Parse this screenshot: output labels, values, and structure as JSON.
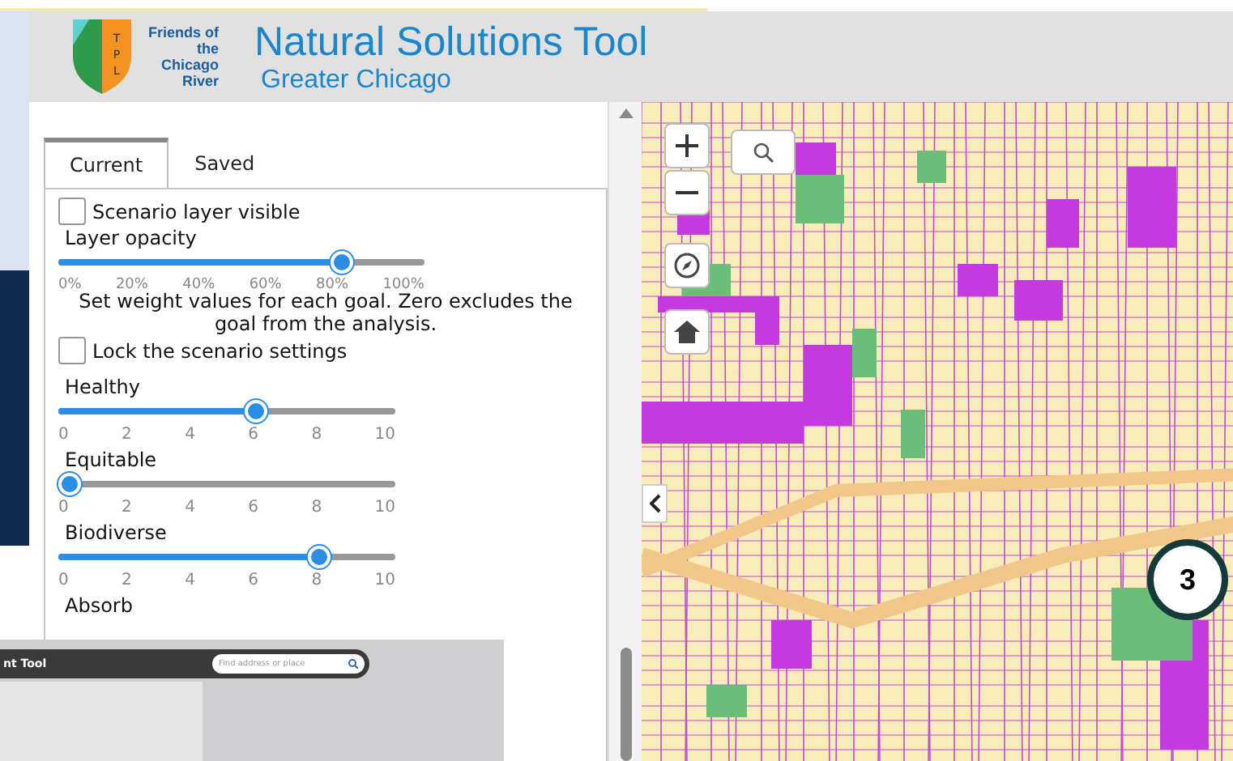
{
  "header": {
    "org_name": "Friends of the Chicago River",
    "logo_letters": "TPL",
    "title": "Natural Solutions Tool",
    "subtitle": "Greater Chicago"
  },
  "tabs": [
    {
      "label": "Current",
      "selected": true
    },
    {
      "label": "Saved",
      "selected": false
    }
  ],
  "layer_visible": {
    "label": "Scenario layer visible",
    "checked": false
  },
  "opacity": {
    "label": "Layer opacity",
    "level": 0.8,
    "ticks": [
      "0%",
      "20%",
      "40%",
      "60%",
      "80%",
      "100%"
    ]
  },
  "instructions": "Set weight values for each goal. Zero excludes the goal from the analysis.",
  "lock": {
    "label": "Lock the scenario settings",
    "checked": false
  },
  "goals": [
    {
      "label": "Healthy",
      "level": 0.6,
      "ticks": [
        "0",
        "2",
        "4",
        "6",
        "8",
        "10"
      ]
    },
    {
      "label": "Equitable",
      "level": 0,
      "ticks": [
        "0",
        "2",
        "4",
        "6",
        "8",
        "10"
      ]
    },
    {
      "label": "Biodiverse",
      "level": 0.8,
      "ticks": [
        "0",
        "2",
        "4",
        "6",
        "8",
        "10"
      ]
    },
    {
      "label": "Absorb"
    }
  ],
  "map": {
    "badge": "3"
  },
  "inset": {
    "title": "nt Tool",
    "search_placeholder": "Find address or place"
  }
}
